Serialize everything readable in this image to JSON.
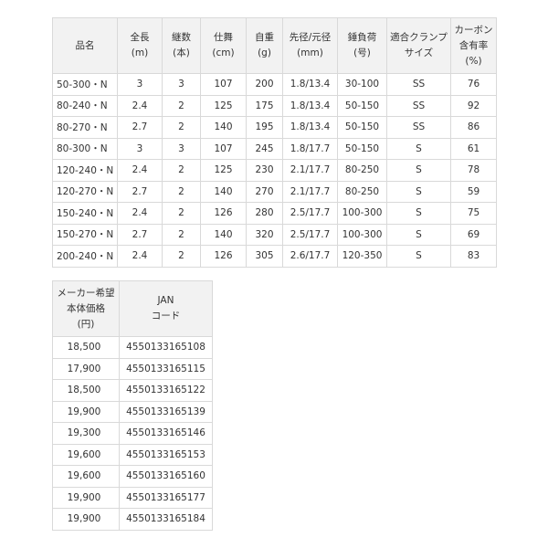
{
  "spec_table": {
    "headers": [
      [
        "品名"
      ],
      [
        "全長",
        "(m)"
      ],
      [
        "継数",
        "(本)"
      ],
      [
        "仕舞",
        "(cm)"
      ],
      [
        "自重",
        "(g)"
      ],
      [
        "先径/元径",
        "(mm)"
      ],
      [
        "錘負荷",
        "(号)"
      ],
      [
        "適合クランプ",
        "サイズ"
      ],
      [
        "カーボン",
        "含有率",
        "(%)"
      ]
    ],
    "rows": [
      [
        "50-300・N",
        "3",
        "3",
        "107",
        "200",
        "1.8/13.4",
        "30-100",
        "SS",
        "76"
      ],
      [
        "80-240・N",
        "2.4",
        "2",
        "125",
        "175",
        "1.8/13.4",
        "50-150",
        "SS",
        "92"
      ],
      [
        "80-270・N",
        "2.7",
        "2",
        "140",
        "195",
        "1.8/13.4",
        "50-150",
        "SS",
        "86"
      ],
      [
        "80-300・N",
        "3",
        "3",
        "107",
        "245",
        "1.8/17.7",
        "50-150",
        "S",
        "61"
      ],
      [
        "120-240・N",
        "2.4",
        "2",
        "125",
        "230",
        "2.1/17.7",
        "80-250",
        "S",
        "78"
      ],
      [
        "120-270・N",
        "2.7",
        "2",
        "140",
        "270",
        "2.1/17.7",
        "80-250",
        "S",
        "59"
      ],
      [
        "150-240・N",
        "2.4",
        "2",
        "126",
        "280",
        "2.5/17.7",
        "100-300",
        "S",
        "75"
      ],
      [
        "150-270・N",
        "2.7",
        "2",
        "140",
        "320",
        "2.5/17.7",
        "100-300",
        "S",
        "69"
      ],
      [
        "200-240・N",
        "2.4",
        "2",
        "126",
        "305",
        "2.6/17.7",
        "120-350",
        "S",
        "83"
      ]
    ]
  },
  "price_table": {
    "headers": [
      [
        "メーカー希望",
        "本体価格",
        "(円)"
      ],
      [
        "JAN",
        "コード"
      ]
    ],
    "rows": [
      [
        "18,500",
        "4550133165108"
      ],
      [
        "17,900",
        "4550133165115"
      ],
      [
        "18,500",
        "4550133165122"
      ],
      [
        "19,900",
        "4550133165139"
      ],
      [
        "19,300",
        "4550133165146"
      ],
      [
        "19,600",
        "4550133165153"
      ],
      [
        "19,600",
        "4550133165160"
      ],
      [
        "19,900",
        "4550133165177"
      ],
      [
        "19,900",
        "4550133165184"
      ]
    ]
  }
}
